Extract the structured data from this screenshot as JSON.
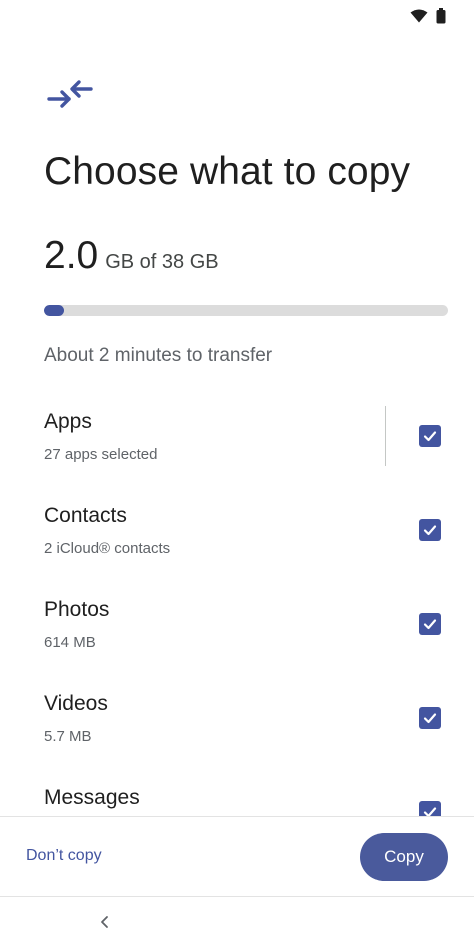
{
  "status_bar": {
    "icons": [
      "wifi-icon",
      "battery-icon"
    ]
  },
  "header": {
    "icon": "transfer-arrows-icon",
    "title": "Choose what to copy"
  },
  "storage": {
    "used": "2.0",
    "total_label": "GB of 38 GB",
    "progress_fraction": 0.05
  },
  "eta": "About 2 minutes to transfer",
  "categories": [
    {
      "title": "Apps",
      "subtitle": "27 apps selected",
      "checked": true
    },
    {
      "title": "Contacts",
      "subtitle": "2 iCloud® contacts",
      "checked": true
    },
    {
      "title": "Photos",
      "subtitle": "614 MB",
      "checked": true
    },
    {
      "title": "Videos",
      "subtitle": "5.7 MB",
      "checked": true
    },
    {
      "title": "Messages",
      "subtitle": "",
      "checked": true
    }
  ],
  "actions": {
    "dont_copy_label": "Don’t copy",
    "copy_label": "Copy"
  },
  "nav": {
    "back_icon": "chevron-left-icon"
  },
  "colors": {
    "accent": "#4355a0",
    "copy_button": "#4a5a9c",
    "track": "#dcdcdc",
    "secondary_text": "#5f6368"
  }
}
